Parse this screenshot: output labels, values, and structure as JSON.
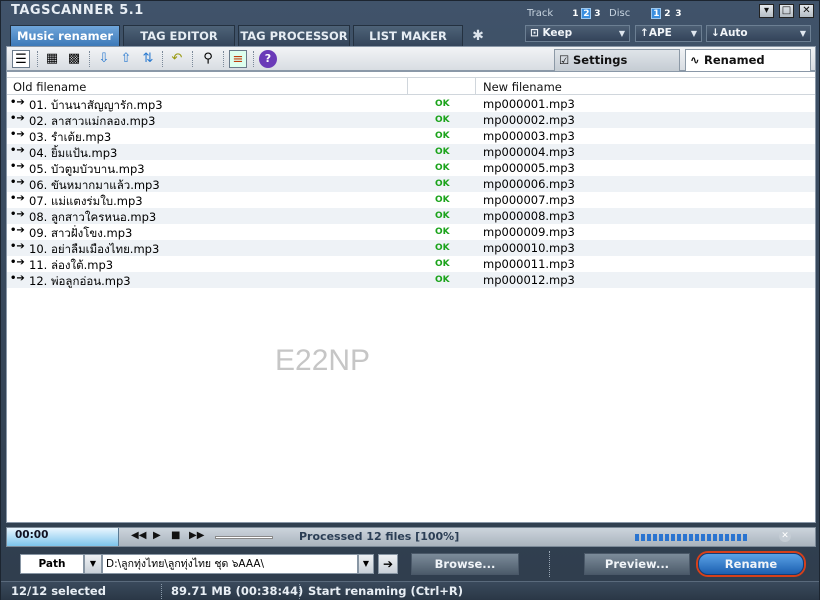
{
  "app": {
    "title": "TAGSCANNER 5.1",
    "track_label": "Track",
    "track_numbers": [
      "1",
      "2",
      "3"
    ],
    "disc_label": "Disc",
    "disc_numbers": [
      "1",
      "2",
      "3"
    ]
  },
  "tabs": [
    {
      "label": "Music renamer"
    },
    {
      "label": "TAG EDITOR"
    },
    {
      "label": "TAG PROCESSOR"
    },
    {
      "label": "LIST MAKER"
    }
  ],
  "dropdowns": {
    "case": "Keep",
    "tag": "APE",
    "mode": "Auto"
  },
  "right_tabs": {
    "settings": "Settings",
    "renamed": "Renamed"
  },
  "columns": {
    "old": "Old filename",
    "new": "New filename"
  },
  "rows": [
    {
      "old": "01. บ้านนาสัญญารัก.mp3",
      "status": "OK",
      "new": "mp000001.mp3"
    },
    {
      "old": "02. ลาสาวแม่กลอง.mp3",
      "status": "OK",
      "new": "mp000002.mp3"
    },
    {
      "old": "03. รำเต้ย.mp3",
      "status": "OK",
      "new": "mp000003.mp3"
    },
    {
      "old": "04. ยิ้มแป้น.mp3",
      "status": "OK",
      "new": "mp000004.mp3"
    },
    {
      "old": "05. บัวตูมบัวบาน.mp3",
      "status": "OK",
      "new": "mp000005.mp3"
    },
    {
      "old": "06. ขันหมากมาแล้ว.mp3",
      "status": "OK",
      "new": "mp000006.mp3"
    },
    {
      "old": "07. แม่แตงร่มใบ.mp3",
      "status": "OK",
      "new": "mp000007.mp3"
    },
    {
      "old": "08. ลูกสาวใครหนอ.mp3",
      "status": "OK",
      "new": "mp000008.mp3"
    },
    {
      "old": "09. สาวฝั่งโขง.mp3",
      "status": "OK",
      "new": "mp000009.mp3"
    },
    {
      "old": "10. อย่าลืมเมืองไทย.mp3",
      "status": "OK",
      "new": "mp000010.mp3"
    },
    {
      "old": "11. ล่องใต้.mp3",
      "status": "OK",
      "new": "mp000011.mp3"
    },
    {
      "old": "12. พ่อลูกอ่อน.mp3",
      "status": "OK",
      "new": "mp000012.mp3"
    }
  ],
  "watermark": "E22NP",
  "player": {
    "time": "00:00",
    "processed": "Processed 12 files [100%]"
  },
  "path": {
    "label": "Path",
    "value": "D:\\ลูกทุ่งไทย\\ลูกทุ่งไทย ชุด ๖AAA\\",
    "browse": "Browse...",
    "preview": "Preview...",
    "rename": "Rename"
  },
  "status": {
    "selected": "12/12 selected",
    "size": "89.71 MB (00:38:44)",
    "hint": "Start renaming (Ctrl+R)"
  },
  "colors": {
    "ok": "#1aa31a",
    "accent": "#3c79b8",
    "rename_ring": "#d6401a"
  }
}
